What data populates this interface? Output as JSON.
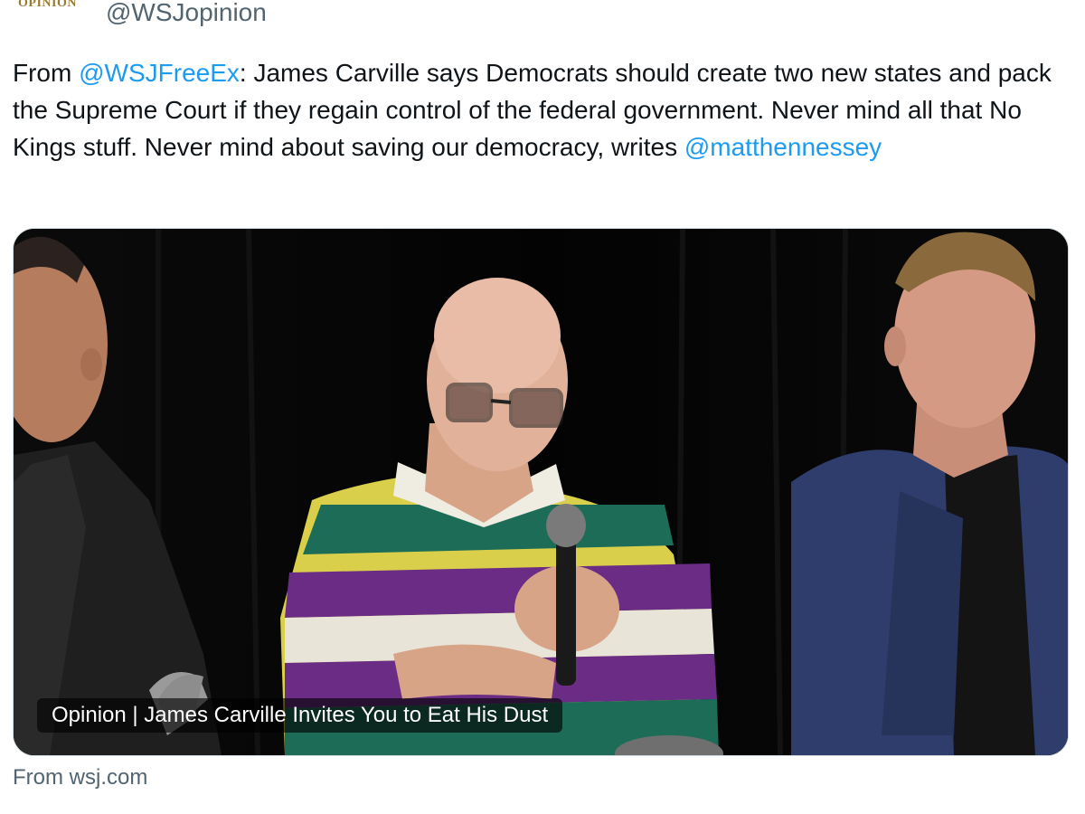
{
  "tweet": {
    "avatar_text": "OPINION",
    "handle": "@WSJopinion",
    "text_prefix": "From ",
    "mention_1": "@WSJFreeEx",
    "text_body": ": James Carville says Democrats should create two new states and pack the Supreme Court if they regain control of the federal government. Never mind all that No Kings stuff. Never mind about saving our democracy, writes ",
    "mention_2": "@matthennessey"
  },
  "card": {
    "title": "Opinion | James Carville Invites You to Eat His Dust",
    "source": "From wsj.com"
  },
  "colors": {
    "link": "#1d9bf0",
    "secondary_text": "#536471",
    "card_border": "#cfd9de"
  }
}
